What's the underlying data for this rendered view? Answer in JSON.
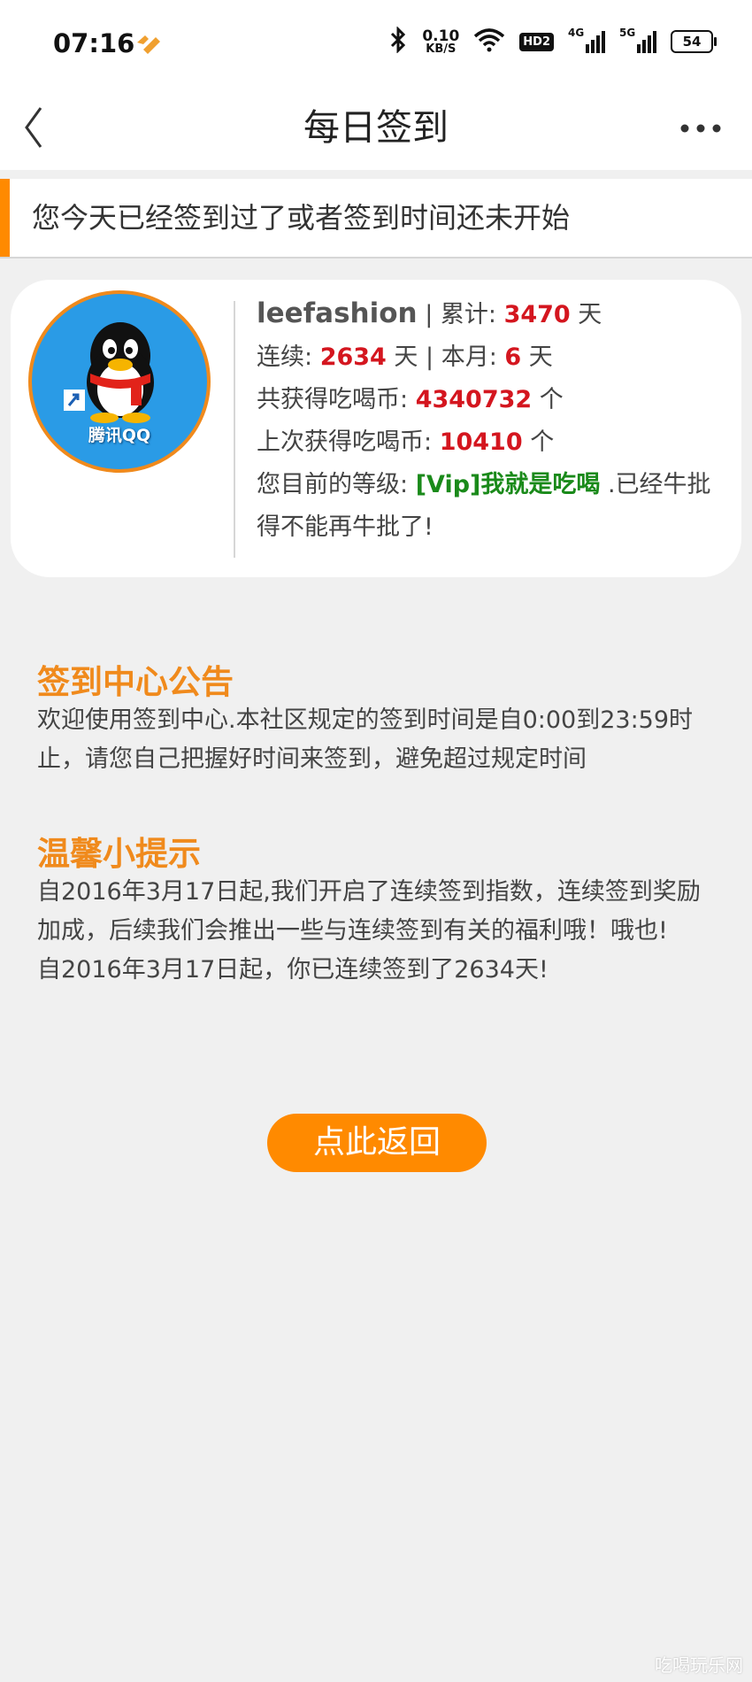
{
  "status_bar": {
    "time": "07:16",
    "net_speed_value": "0.10",
    "net_speed_unit": "KB/S",
    "hd_label": "HD2",
    "signal_1_label": "4G",
    "signal_2_label": "5G",
    "battery_level": "54",
    "icons": [
      "app-notification-icon",
      "bluetooth-icon",
      "wifi-icon",
      "signal-icon",
      "battery-icon"
    ]
  },
  "header": {
    "title": "每日签到",
    "back_icon": "chevron-left-icon",
    "more_icon": "more-dots-icon"
  },
  "notice": {
    "text": "您今天已经签到过了或者签到时间还未开始",
    "accent_color": "#ff8a00"
  },
  "user": {
    "avatar_label": "腾讯QQ",
    "username": "leefashion",
    "total_label": " | 累计: ",
    "total_days": "3470",
    "day_unit": " 天",
    "streak_label": "连续: ",
    "streak_days": "2634",
    "month_label": " 天 | 本月: ",
    "month_days": "6",
    "month_unit": " 天",
    "coins_total_label": "共获得吃喝币: ",
    "coins_total": "4340732",
    "coins_unit": " 个",
    "coins_last_label": "上次获得吃喝币: ",
    "coins_last": "10410",
    "coins_last_unit": " 个",
    "level_label": "您目前的等级: ",
    "level_name": "[Vip]我就是吃喝",
    "level_note": " .已经牛批得不能再牛批了!",
    "value_color": "#d4161f",
    "level_color": "#1a8a1a"
  },
  "announcement": {
    "title": "签到中心公告",
    "body": "欢迎使用签到中心.本社区规定的签到时间是自0:00到23:59时止，请您自己把握好时间来签到，避免超过规定时间"
  },
  "tips": {
    "title": "温馨小提示",
    "line1": "自2016年3月17日起,我们开启了连续签到指数，连续签到奖励加成，后续我们会推出一些与连续签到有关的福利哦！哦也!",
    "line2": "自2016年3月17日起，你已连续签到了2634天!"
  },
  "actions": {
    "return_label": "点此返回",
    "button_color": "#ff8a00"
  },
  "watermark": "吃喝玩乐网"
}
